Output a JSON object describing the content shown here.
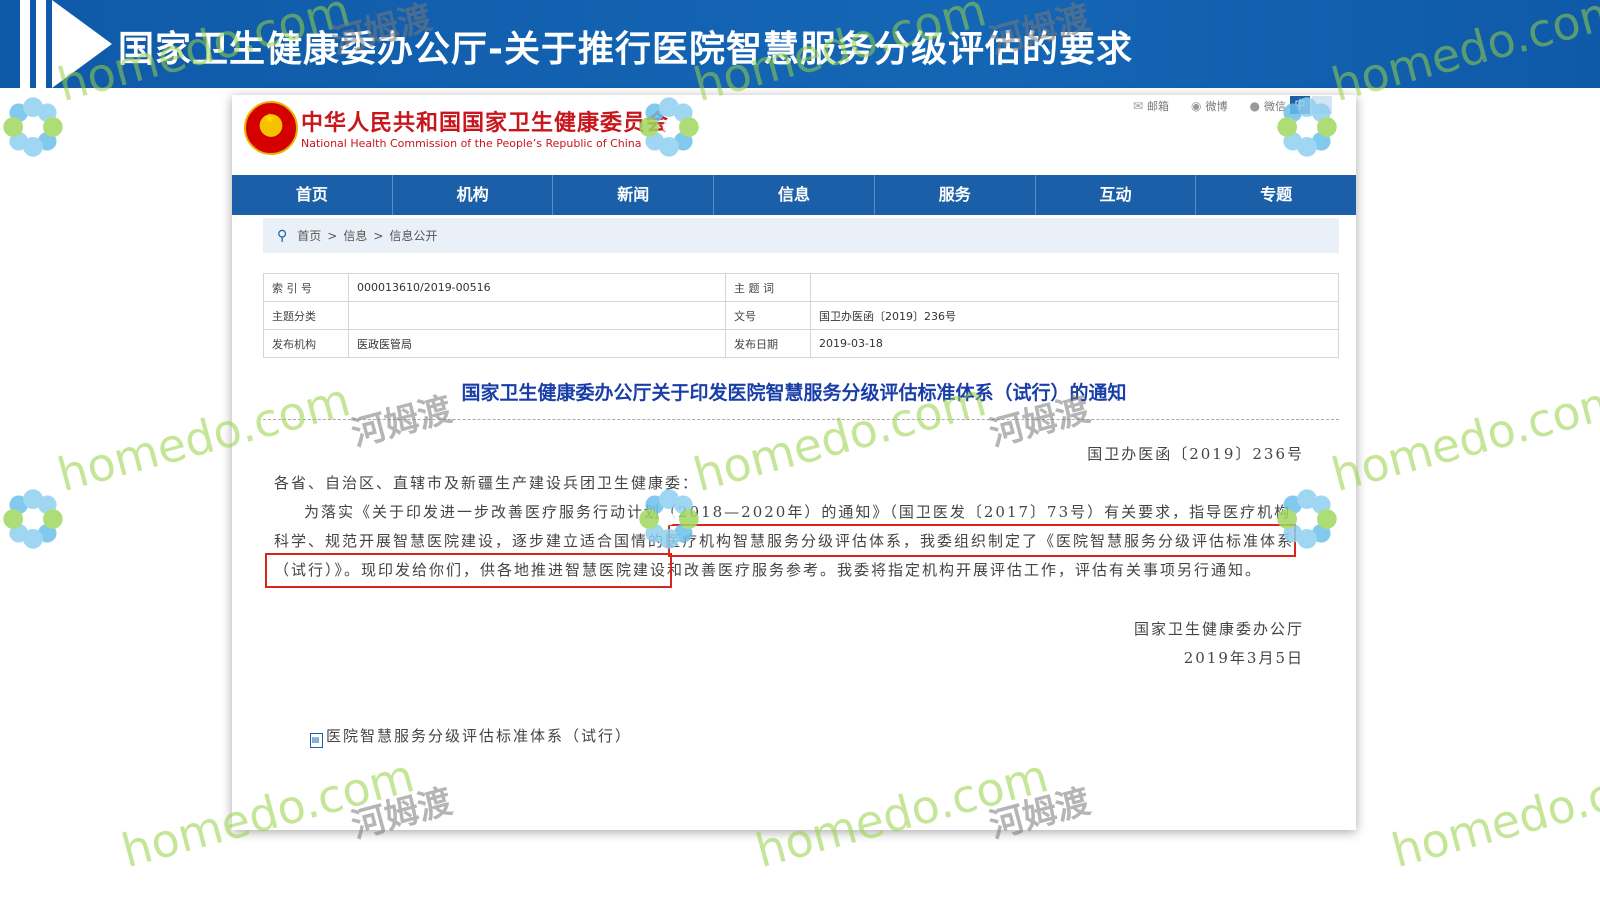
{
  "slide": {
    "title": "国家卫生健康委办公厅-关于推行医院智慧服务分级评估的要求"
  },
  "site": {
    "name_cn": "中华人民共和国国家卫生健康委员会",
    "name_en": "National Health Commission of the People’s Republic of China",
    "top_links": [
      {
        "label": "邮箱",
        "icon": "mail-icon"
      },
      {
        "label": "微博",
        "icon": "weibo-icon"
      },
      {
        "label": "微信",
        "icon": "wechat-icon"
      }
    ],
    "lang": "中",
    "nav": [
      "首页",
      "机构",
      "新闻",
      "信息",
      "服务",
      "互动",
      "专题"
    ],
    "breadcrumb": [
      "首页",
      "信息",
      "信息公开"
    ]
  },
  "meta": {
    "rows": [
      {
        "k1": "索 引 号",
        "v1": "000013610/2019-00516",
        "k2": "主 题 词",
        "v2": ""
      },
      {
        "k1": "主题分类",
        "v1": "",
        "k2": "文号",
        "v2": "国卫办医函〔2019〕236号"
      },
      {
        "k1": "发布机构",
        "v1": "医政医管局",
        "k2": "发布日期",
        "v2": "2019-03-18"
      }
    ]
  },
  "doc": {
    "title": "国家卫生健康委办公厅关于印发医院智慧服务分级评估标准体系（试行）的通知",
    "number": "国卫办医函〔2019〕236号",
    "salutation": "各省、自治区、直辖市及新疆生产建设兵团卫生健康委：",
    "body": "为落实《关于印发进一步改善医疗服务行动计划（2018—2020年）的通知》（国卫医发〔2017〕73号）有关要求，指导医疗机构科学、规范开展智慧医院建设，逐步建立适合国情的医疗机构智慧服务分级评估体系，我委组织制定了《医院智慧服务分级评估标准体系（试行）》。现印发给你们，供各地推进智慧医院建设和改善医疗服务参考。我委将指定机构开展评估工作，评估有关事项另行通知。",
    "signer": "国家卫生健康委办公厅",
    "date": "2019年3月5日",
    "attachment": "医院智慧服务分级评估标准体系（试行）"
  },
  "watermark": {
    "en": "homedo.com",
    "cn": "河姆渡"
  },
  "colors": {
    "header_blue": "#1466b5",
    "nav_blue": "#1a5fa8",
    "site_red": "#c8161d",
    "title_blue": "#1a3ea8",
    "highlight_red": "#d9261c"
  }
}
